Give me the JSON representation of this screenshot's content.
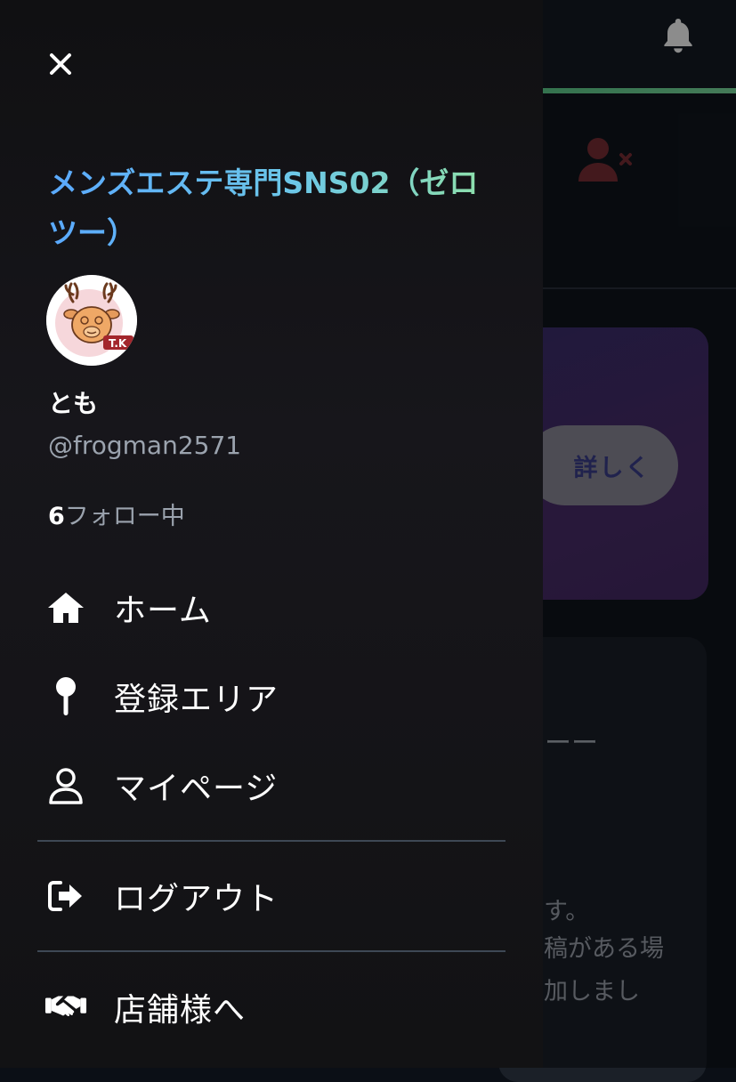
{
  "drawer": {
    "site_title": "メンズエステ専門SNS02（ゼロツー）",
    "user": {
      "name": "とも",
      "handle": "@frogman2571",
      "follow_count": "6",
      "follow_suffix": "フォロー中"
    },
    "menu": [
      {
        "label": "ホーム",
        "icon": "home-icon"
      },
      {
        "label": "登録エリア",
        "icon": "map-pin-icon"
      },
      {
        "label": "マイページ",
        "icon": "user-icon"
      },
      {
        "label": "ログアウト",
        "icon": "logout-icon"
      },
      {
        "label": "店舗様へ",
        "icon": "handshake-icon"
      }
    ]
  },
  "background": {
    "details_button": "詳しく",
    "dash_text": "ーー",
    "text_lines": [
      "す。",
      "稿がある場",
      "加しまし"
    ]
  },
  "colors": {
    "drawer_bg": "#121214",
    "title_gradient_start": "#5aa9ff",
    "title_gradient_end": "#8fe0a8",
    "accent_red": "#7a2f35",
    "promo_purple": "#3b2e6d"
  }
}
